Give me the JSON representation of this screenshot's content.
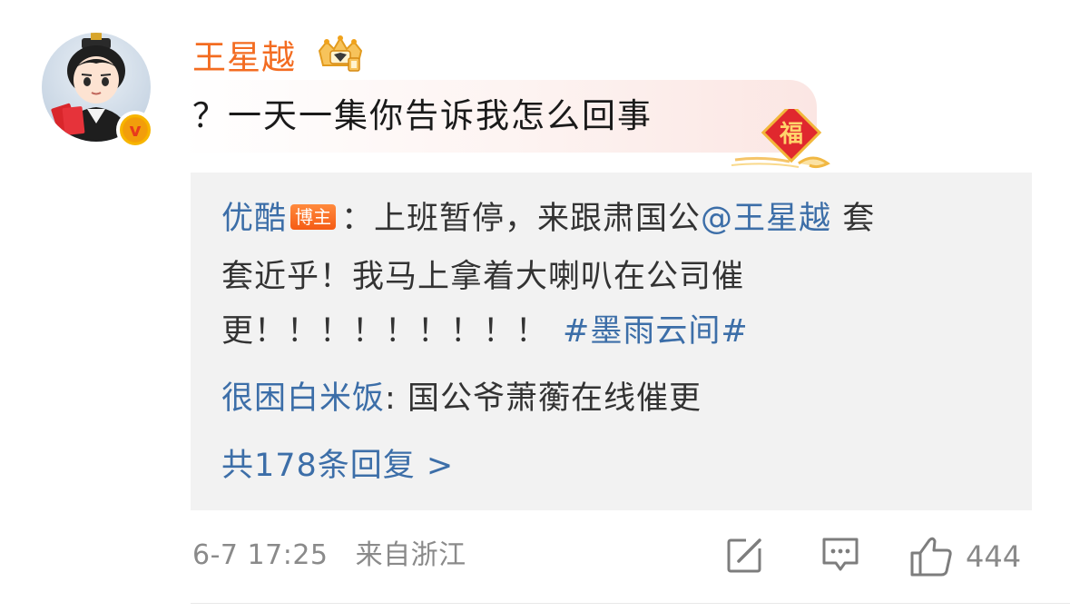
{
  "comment": {
    "username": "王星越",
    "text": "？一天一集你告诉我怎么回事",
    "badge_icon": "crown-badge-icon",
    "festival_badge": "福"
  },
  "replies": {
    "items": [
      {
        "author": "优酷",
        "author_badge": "博主",
        "separator": "：",
        "text_line1_a": "上班暂停，来跟肃国公",
        "mention": "@王星越",
        "text_line1_b": " 套",
        "text_line2": "套近乎！我马上拿着大喇叭在公司催",
        "text_line3": "更！！！！！！！！！",
        "hashtag": "#墨雨云间#"
      },
      {
        "author": "很困白米饭",
        "separator": ":",
        "text": " 国公爷萧蘅在线催更"
      }
    ],
    "more_label": "共178条回复 >"
  },
  "footer": {
    "timestamp": "6-7 17:25",
    "location": "来自浙江",
    "like_count": "444"
  },
  "colors": {
    "username": "#f36c21",
    "link": "#3c6ea8",
    "reply_bg": "#f2f2f2",
    "meta": "#8a8a8a"
  }
}
